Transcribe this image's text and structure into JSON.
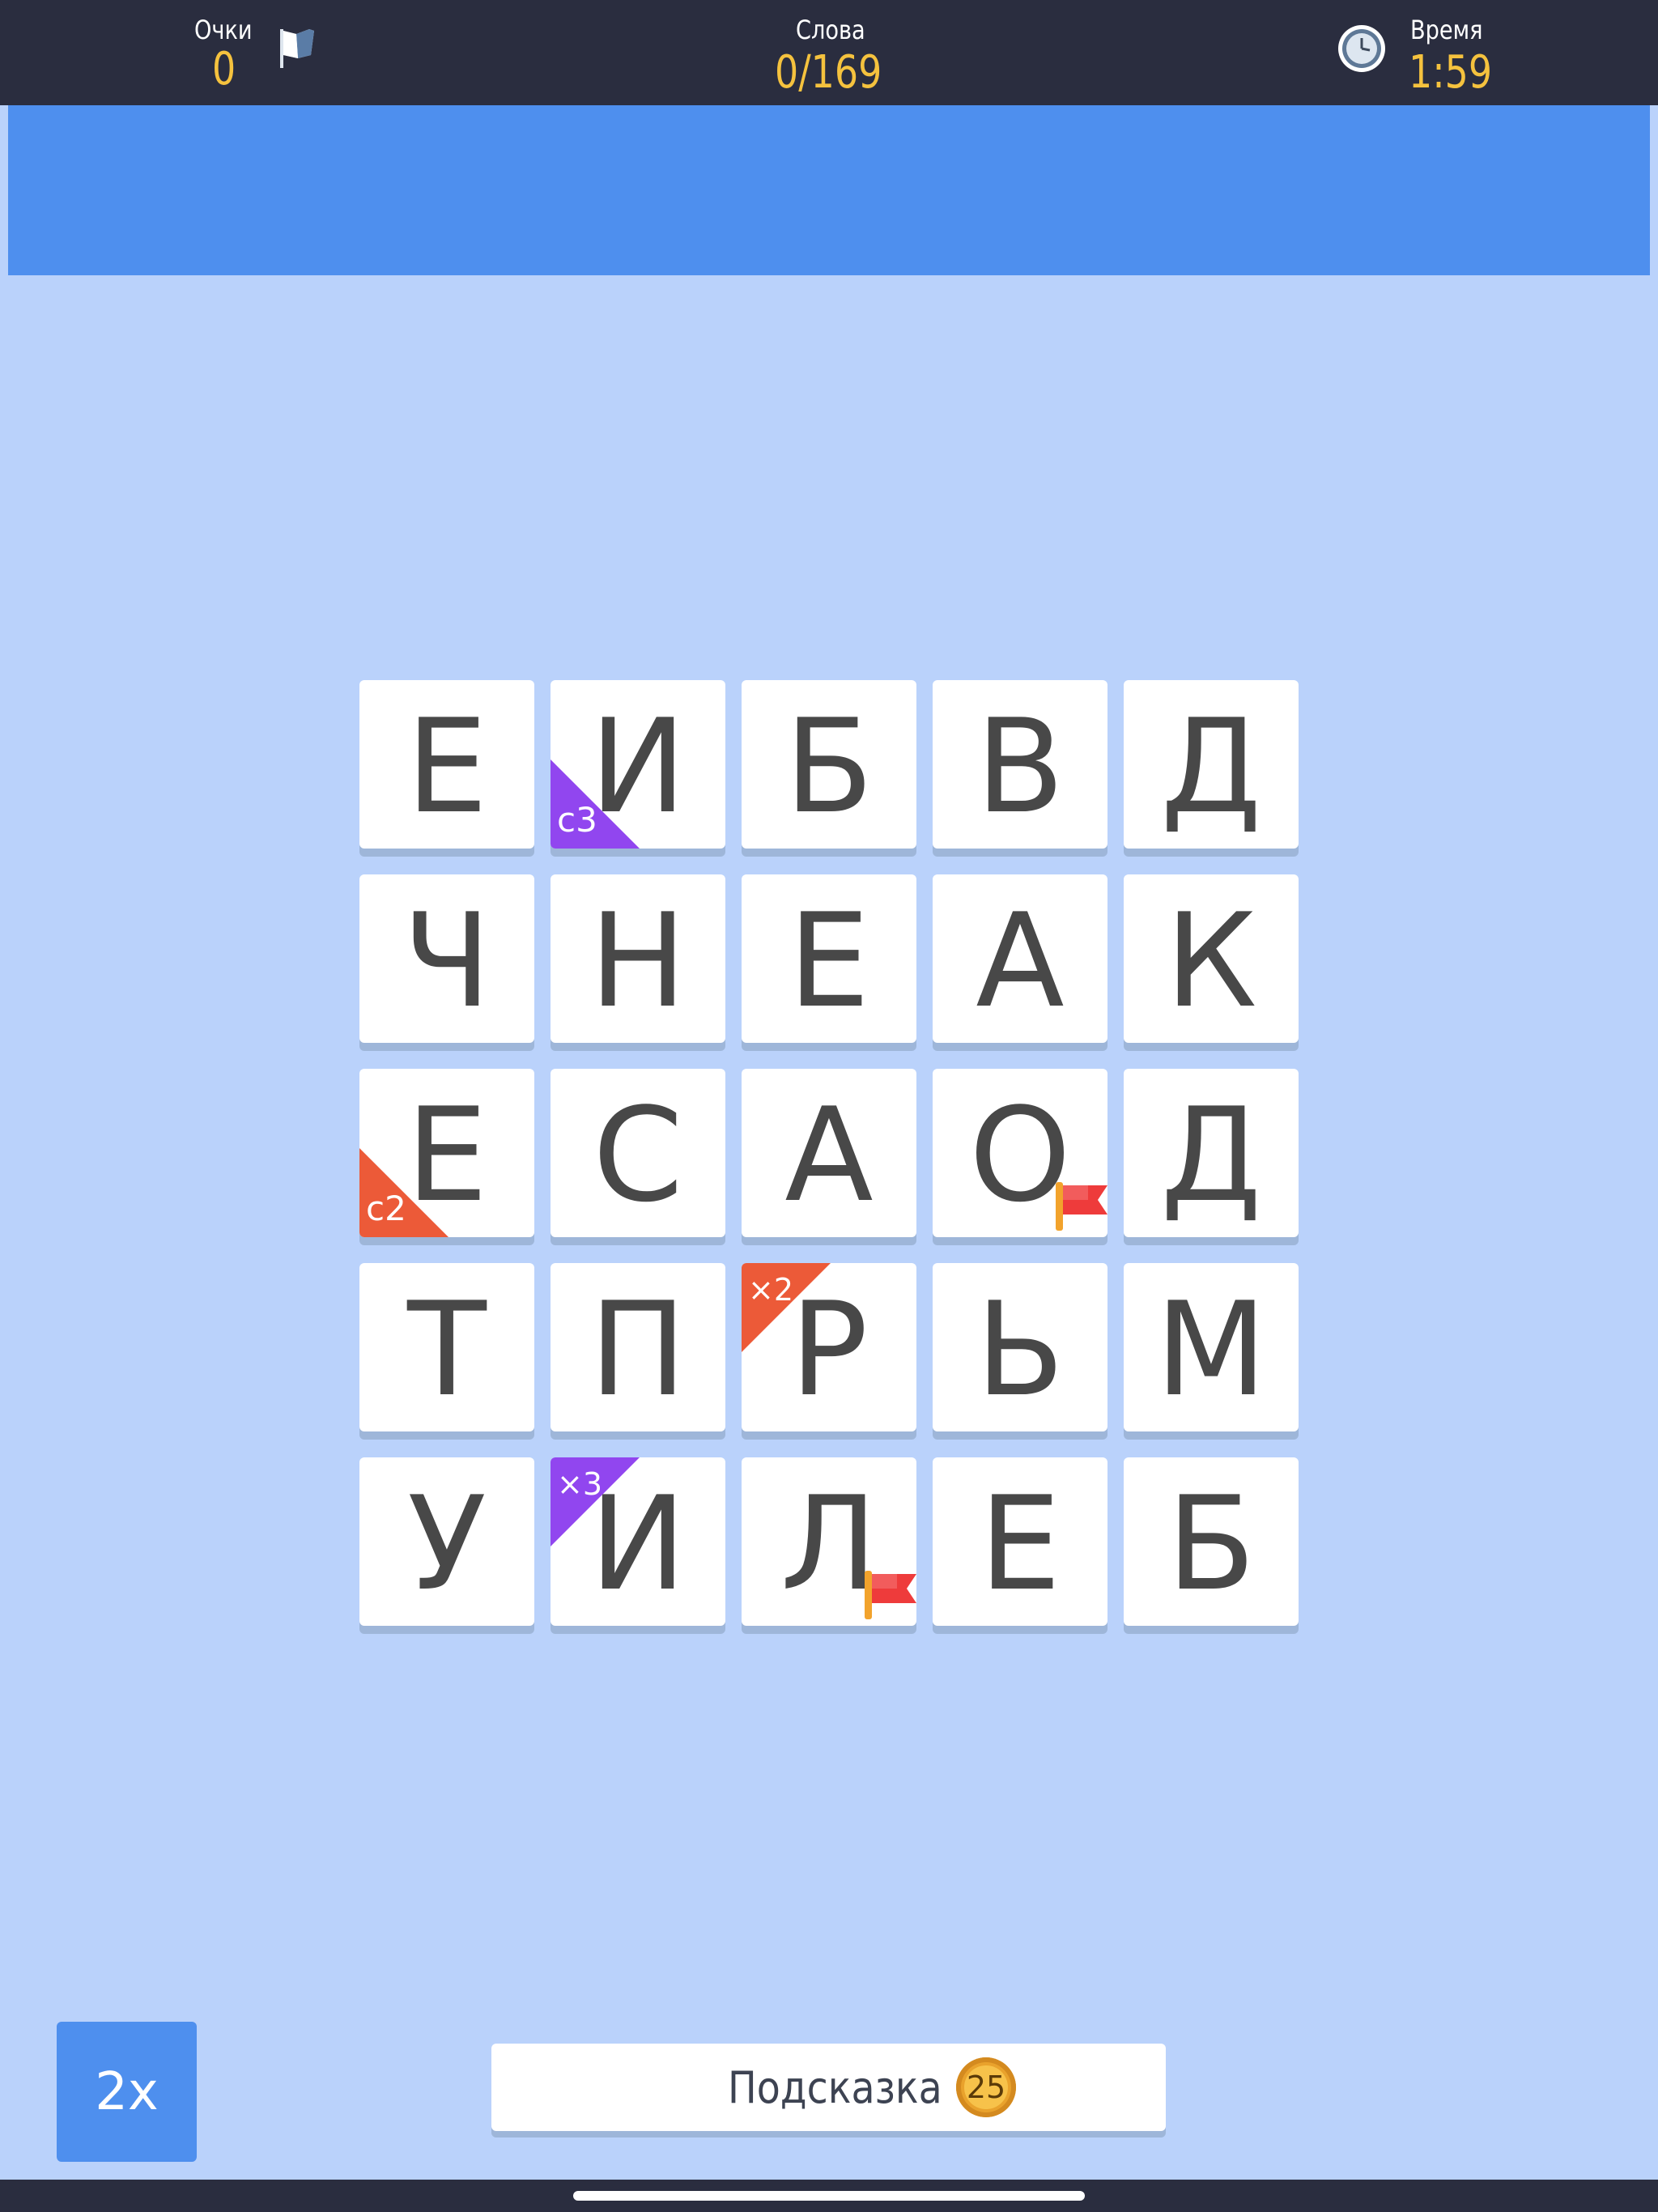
{
  "header": {
    "score_label": "Очки",
    "score_value": "0",
    "words_label": "Слова",
    "words_value": "0/169",
    "time_label": "Время",
    "time_value": "1:59"
  },
  "colors": {
    "header_bg": "#2a2d3f",
    "accent_yellow": "#f5c23e",
    "panel_blue": "#4e8fee",
    "board_bg": "#bad2fb",
    "badge_purple": "#9146ef",
    "badge_red": "#ec5a38"
  },
  "grid": {
    "rows": [
      [
        {
          "letter": "Е"
        },
        {
          "letter": "И",
          "badge": {
            "text": "c3",
            "color": "purple",
            "corner": "bottom-left"
          }
        },
        {
          "letter": "Б"
        },
        {
          "letter": "В"
        },
        {
          "letter": "Д"
        }
      ],
      [
        {
          "letter": "Ч"
        },
        {
          "letter": "Н"
        },
        {
          "letter": "Е"
        },
        {
          "letter": "А"
        },
        {
          "letter": "К"
        }
      ],
      [
        {
          "letter": "Е",
          "badge": {
            "text": "c2",
            "color": "red",
            "corner": "bottom-left"
          }
        },
        {
          "letter": "С"
        },
        {
          "letter": "А"
        },
        {
          "letter": "О",
          "flag": true
        },
        {
          "letter": "Д"
        }
      ],
      [
        {
          "letter": "Т"
        },
        {
          "letter": "П"
        },
        {
          "letter": "Р",
          "badge": {
            "text": "×2",
            "color": "red",
            "corner": "top-left"
          }
        },
        {
          "letter": "Ь"
        },
        {
          "letter": "М"
        }
      ],
      [
        {
          "letter": "У"
        },
        {
          "letter": "И",
          "badge": {
            "text": "×3",
            "color": "purple",
            "corner": "top-left"
          }
        },
        {
          "letter": "Л",
          "flag": true
        },
        {
          "letter": "Е"
        },
        {
          "letter": "Б"
        }
      ]
    ]
  },
  "controls": {
    "multiplier_label": "2x",
    "hint_label": "Подсказка",
    "hint_cost": "25"
  },
  "icons": {
    "score": "flag-icon",
    "time": "clock-icon",
    "tile_flag": "red-flag-icon"
  }
}
